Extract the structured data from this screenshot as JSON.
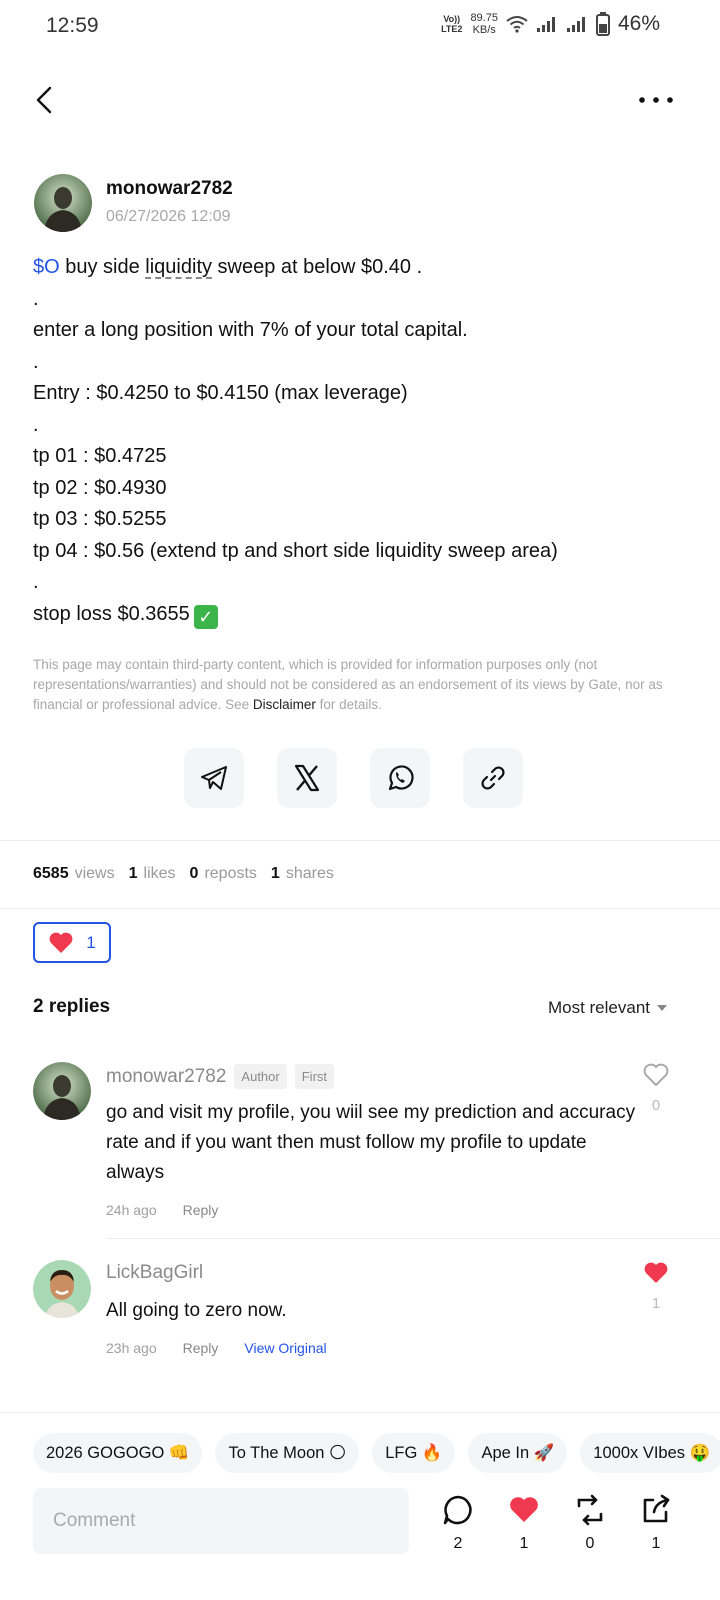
{
  "status": {
    "time": "12:59",
    "volte_top": "Vo))",
    "volte_bottom": "LTE2",
    "speed_value": "89.75",
    "speed_unit": "KB/s",
    "battery": "46%"
  },
  "post": {
    "author": "monowar2782",
    "date": "06/27/2026 12:09",
    "lines": {
      "l1_ticker": "$O",
      "l1_pre": " buy side ",
      "l1_underlined": "liquidity",
      "l1_post": " sweep at below $0.40 .",
      "d1": ".",
      "l2": "enter a long position with 7% of your total capital.",
      "d2": ".",
      "l3": "Entry : $0.4250 to $0.4150 (max leverage)",
      "d3": ".",
      "tp1": "tp 01 : $0.4725",
      "tp2": "tp 02 : $0.4930",
      "tp3": "tp 03 : $0.5255",
      "tp4": "tp 04 : $0.56 (extend tp and short side liquidity sweep area)",
      "d4": ".",
      "sl": "stop loss $0.3655",
      "check": "✓"
    },
    "disclaimer_pre": "This page may contain third-party content, which is provided for information purposes only (not representations/warranties) and should not be considered as an endorsement of its views by Gate, nor as financial or professional advice. See ",
    "disclaimer_link": "Disclaimer",
    "disclaimer_post": " for details."
  },
  "share_icons": [
    "telegram-icon",
    "x-icon",
    "whatsapp-icon",
    "link-icon"
  ],
  "stats": {
    "views_num": "6585",
    "views_label": "views",
    "likes_num": "1",
    "likes_label": "likes",
    "reposts_num": "0",
    "reposts_label": "reposts",
    "shares_num": "1",
    "shares_label": "shares"
  },
  "like_chip": {
    "count": "1"
  },
  "replies": {
    "header": "2 replies",
    "sort": "Most relevant",
    "items": [
      {
        "user": "monowar2782",
        "tag1": "Author",
        "tag2": "First",
        "text": "go and visit my profile, you wiil see my prediction and accuracy rate and if you want then must follow my profile to update always",
        "time": "24h ago",
        "reply": "Reply",
        "likes": "0"
      },
      {
        "user": "LickBagGirl",
        "text": "All going to zero now.",
        "time": "23h ago",
        "reply": "Reply",
        "view_original": "View Original",
        "likes": "1"
      }
    ]
  },
  "quick_chips": [
    "2026 GOGOGO 👊",
    "To The Moon 🌕",
    "LFG 🔥",
    "Ape In 🚀",
    "1000x VIbes 🤑"
  ],
  "bottom_bar": {
    "comment_placeholder": "Comment",
    "comments": "2",
    "likes": "1",
    "reposts": "0",
    "shares": "1"
  },
  "colors": {
    "accent": "#2354e6",
    "like": "#f0394f",
    "muted": "#a8a8a8"
  }
}
